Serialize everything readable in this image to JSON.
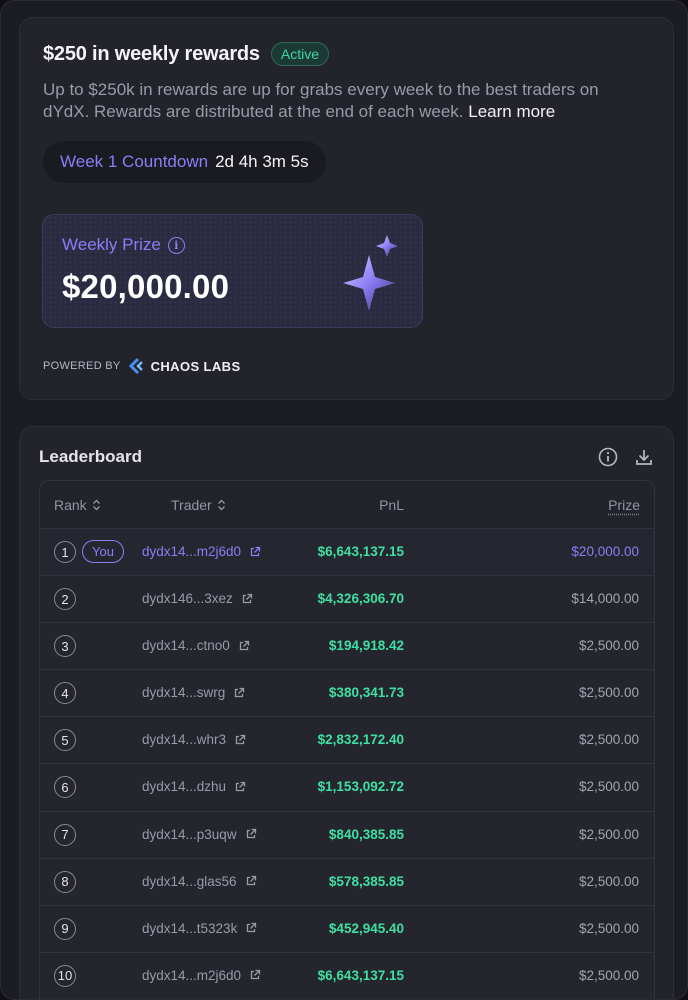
{
  "rewards": {
    "title": "$250 in weekly rewards",
    "status": "Active",
    "description": "Up to $250k in rewards are up for grabs every week to the best traders on dYdX. Rewards are distributed at the end of each week.",
    "learn_more": "Learn more",
    "countdown_label": "Week 1 Countdown",
    "countdown_value": "2d 4h 3m 5s",
    "prize_label": "Weekly Prize",
    "prize_amount": "$20,000.00",
    "powered_by": "POWERED BY",
    "brand": "CHAOS LABS"
  },
  "leaderboard": {
    "title": "Leaderboard",
    "columns": {
      "rank": "Rank",
      "trader": "Trader",
      "pnl": "PnL",
      "prize": "Prize"
    },
    "you_label": "You",
    "rows": [
      {
        "rank": "1",
        "trader": "dydx14...m2j6d0",
        "pnl": "$6,643,137.15",
        "prize": "$20,000.00"
      },
      {
        "rank": "2",
        "trader": "dydx146...3xez",
        "pnl": "$4,326,306.70",
        "prize": "$14,000.00"
      },
      {
        "rank": "3",
        "trader": "dydx14...ctno0",
        "pnl": "$194,918.42",
        "prize": "$2,500.00"
      },
      {
        "rank": "4",
        "trader": "dydx14...swrg",
        "pnl": "$380,341.73",
        "prize": "$2,500.00"
      },
      {
        "rank": "5",
        "trader": "dydx14...whr3",
        "pnl": "$2,832,172.40",
        "prize": "$2,500.00"
      },
      {
        "rank": "6",
        "trader": "dydx14...dzhu",
        "pnl": "$1,153,092.72",
        "prize": "$2,500.00"
      },
      {
        "rank": "7",
        "trader": "dydx14...p3uqw",
        "pnl": "$840,385.85",
        "prize": "$2,500.00"
      },
      {
        "rank": "8",
        "trader": "dydx14...glas56",
        "pnl": "$578,385.85",
        "prize": "$2,500.00"
      },
      {
        "rank": "9",
        "trader": "dydx14...t5323k",
        "pnl": "$452,945.40",
        "prize": "$2,500.00"
      },
      {
        "rank": "10",
        "trader": "dydx14...m2j6d0",
        "pnl": "$6,643,137.15",
        "prize": "$2,500.00"
      }
    ]
  },
  "colors": {
    "accent": "#8c7cf6",
    "positive": "#3ee0a2",
    "active_badge": "#3fd6a0",
    "background": "#1c1c23",
    "card": "#23232c"
  },
  "icons": [
    "info-icon",
    "download-icon",
    "external-link-icon",
    "sort-icon",
    "sparkle-icon",
    "chaos-labs-logo"
  ]
}
